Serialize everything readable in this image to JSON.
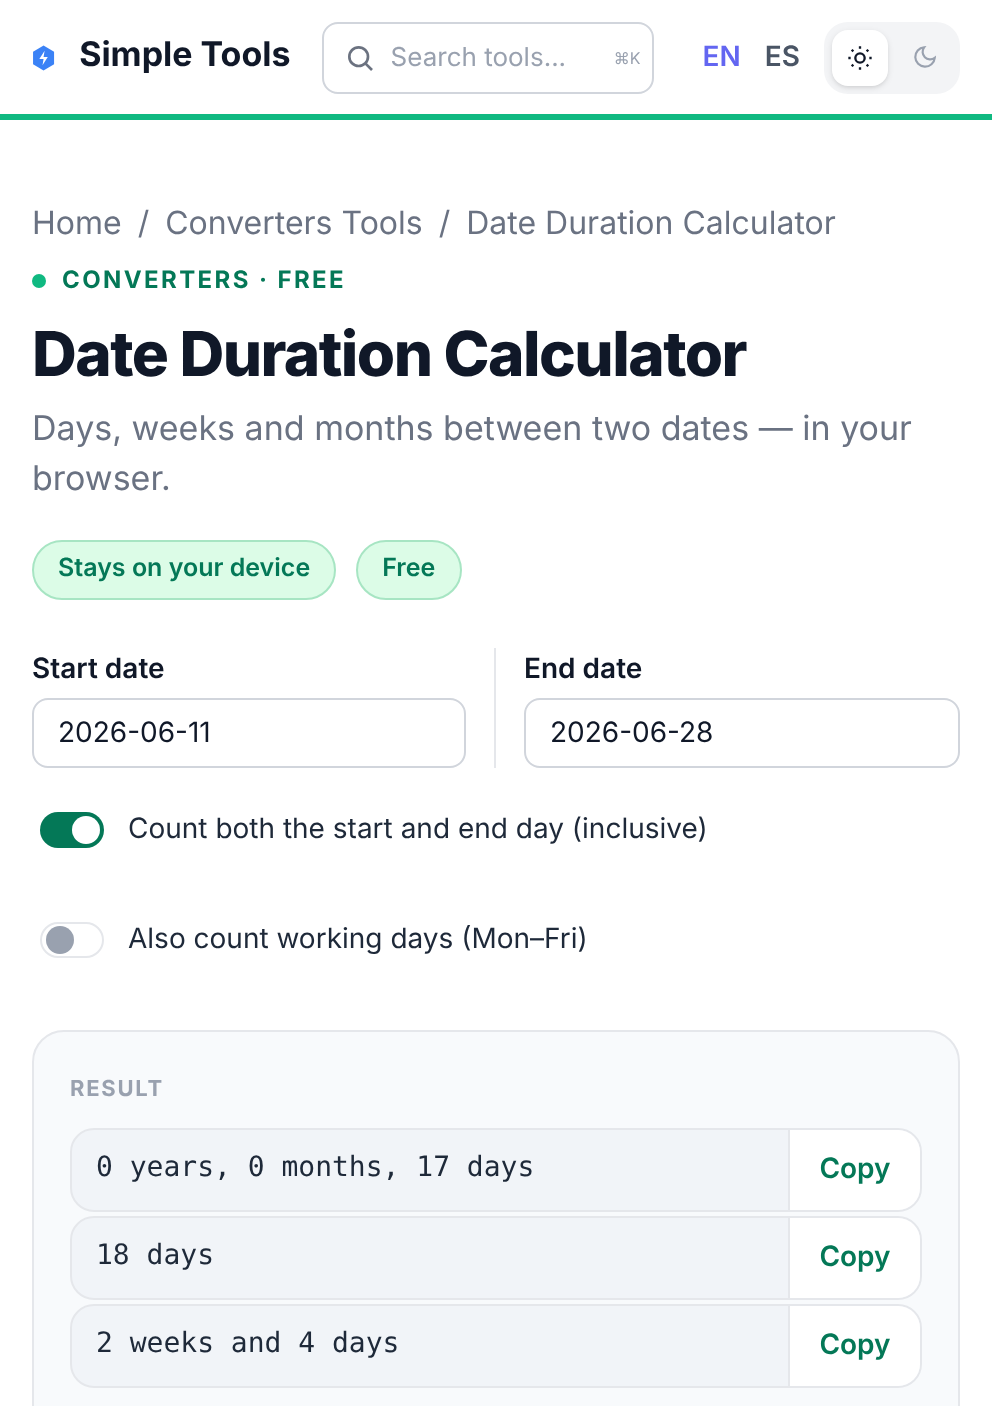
{
  "header": {
    "brand": "Simple Tools",
    "search": {
      "placeholder": "Search tools...",
      "shortcut": "⌘K"
    },
    "languages": [
      {
        "label": "EN",
        "selected": true
      },
      {
        "label": "ES",
        "selected": false
      }
    ],
    "theme": [
      {
        "kind": "light",
        "selected": true
      },
      {
        "kind": "dark",
        "selected": false
      }
    ]
  },
  "breadcrumb": {
    "separator": "/",
    "items": [
      "Home",
      "Converters Tools",
      "Date Duration Calculator"
    ]
  },
  "category": "CONVERTERS · FREE",
  "title": "Date Duration Calculator",
  "subtitle": "Days, weeks and months between two dates — in your browser.",
  "badges": [
    "Stays on your device",
    "Free"
  ],
  "dates": [
    {
      "label": "Start date",
      "value": "2026-06-11"
    },
    {
      "label": "End date",
      "value": "2026-06-28"
    }
  ],
  "options": [
    {
      "label": "Count both the start and end day (inclusive)",
      "on": true
    },
    {
      "label": "Also count working days (Mon–Fri)",
      "on": false
    }
  ],
  "result": {
    "heading": "RESULT",
    "rows": [
      {
        "value": "0 years, 0 months, 17 days",
        "action": "Copy"
      },
      {
        "value": "18 days",
        "action": "Copy"
      },
      {
        "value": "2 weeks and 4 days",
        "action": "Copy"
      }
    ]
  }
}
